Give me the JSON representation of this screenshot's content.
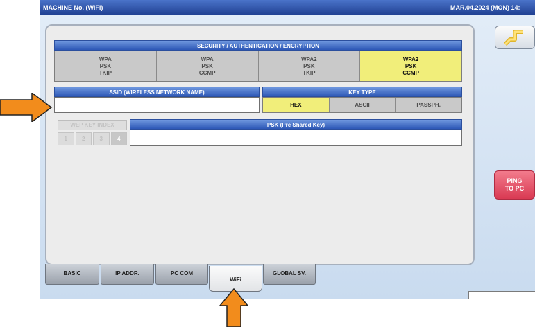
{
  "title_bar": {
    "left": "MACHINE No. (WiFi)",
    "right": "MAR.04.2024 (MON) 14:"
  },
  "security": {
    "header": "SECURITY / AUTHENTICATION / ENCRYPTION",
    "options": [
      {
        "l1": "WPA",
        "l2": "PSK",
        "l3": "TKIP",
        "selected": false
      },
      {
        "l1": "WPA",
        "l2": "PSK",
        "l3": "CCMP",
        "selected": false
      },
      {
        "l1": "WPA2",
        "l2": "PSK",
        "l3": "TKIP",
        "selected": false
      },
      {
        "l1": "WPA2",
        "l2": "PSK",
        "l3": "CCMP",
        "selected": true
      }
    ]
  },
  "ssid": {
    "header": "SSID (WIRELESS NETWORK NAME)",
    "value": ""
  },
  "key_type": {
    "header": "KEY TYPE",
    "options": [
      {
        "label": "HEX",
        "selected": true
      },
      {
        "label": "ASCII",
        "selected": false
      },
      {
        "label": "PASSPH.",
        "selected": false
      }
    ]
  },
  "wep_key_index": {
    "label": "WEP KEY INDEX",
    "keys": [
      "1",
      "2",
      "3",
      "4"
    ],
    "enabled": false
  },
  "psk": {
    "header": "PSK (Pre Shared Key)",
    "value": ""
  },
  "ping_button": {
    "l1": "PING",
    "l2": "TO PC"
  },
  "back_icon": "return-arrow-icon",
  "tabs": [
    {
      "label": "BASIC",
      "active": false
    },
    {
      "label": "IP ADDR.",
      "active": false
    },
    {
      "label": "PC COM",
      "active": false
    },
    {
      "label": "WiFi",
      "active": true
    },
    {
      "label": "GLOBAL SV.",
      "active": false
    }
  ],
  "colors": {
    "title_bar": "#1f3f91",
    "selected": "#f1ee7a",
    "ping": "#d93a53",
    "annotation_arrow": "#f28c1c"
  }
}
